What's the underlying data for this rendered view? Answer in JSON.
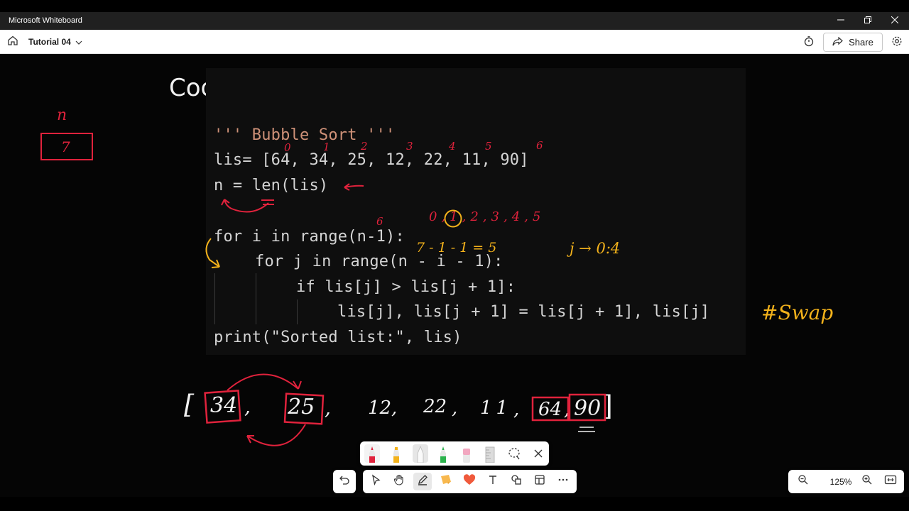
{
  "window": {
    "title": "Microsoft Whiteboard"
  },
  "appbar": {
    "board_title": "Tutorial 04",
    "share_label": "Share"
  },
  "canvas": {
    "heading": "Code",
    "code_lines": [
      "''' Bubble Sort '''",
      "lis= [64, 34, 25, 12, 22, 11, 90]",
      "n = len(lis)",
      "for i in range(n-1):",
      "for j in range(n - i - 1):",
      "if lis[j] > lis[j + 1]:",
      "lis[j], lis[j + 1] = lis[j + 1], lis[j]",
      "print(\"Sorted list:\", lis)"
    ],
    "annotations": {
      "n_label": "n",
      "n_value": "7",
      "indices": [
        "0",
        "1",
        "2",
        "3",
        "4",
        "5",
        "6"
      ],
      "i_range": "0,1,2,3,4,5",
      "six": "6",
      "calc": "7 - 1 - 1 = 5",
      "j_range": "j → 0:4",
      "swap": "#Swap",
      "array": [
        "[",
        "34",
        ",",
        "25",
        ",",
        "12",
        ",",
        "22",
        ",",
        "11",
        ",",
        "64",
        ",",
        "90",
        "]"
      ]
    },
    "colors": {
      "red_ink": "#e0223c",
      "yellow_ink": "#f3b21b",
      "background": "#050505"
    }
  },
  "pen_tray": {
    "pens": [
      {
        "name": "red-pen-icon",
        "color": "#e0223c"
      },
      {
        "name": "yellow-highlighter-icon",
        "color": "#f3b21b"
      },
      {
        "name": "white-pen-icon",
        "color": "#e8e8e8"
      },
      {
        "name": "green-pen-icon",
        "color": "#2bb24c"
      },
      {
        "name": "eraser-icon",
        "color": "#f2a7c0"
      },
      {
        "name": "ruler-icon",
        "color": "#cfcfcf"
      }
    ]
  },
  "zoom": {
    "level": "125%"
  }
}
